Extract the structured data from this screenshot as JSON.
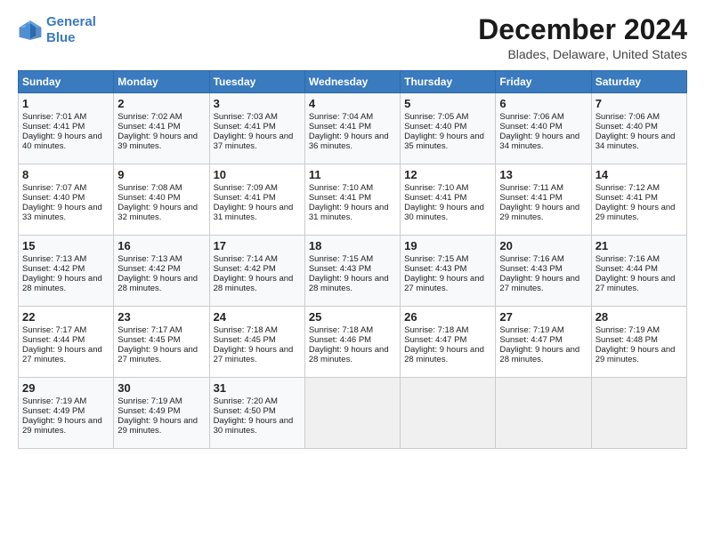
{
  "logo": {
    "line1": "General",
    "line2": "Blue"
  },
  "title": "December 2024",
  "subtitle": "Blades, Delaware, United States",
  "headers": [
    "Sunday",
    "Monday",
    "Tuesday",
    "Wednesday",
    "Thursday",
    "Friday",
    "Saturday"
  ],
  "weeks": [
    [
      {
        "day": "1",
        "sunrise": "Sunrise: 7:01 AM",
        "sunset": "Sunset: 4:41 PM",
        "daylight": "Daylight: 9 hours and 40 minutes."
      },
      {
        "day": "2",
        "sunrise": "Sunrise: 7:02 AM",
        "sunset": "Sunset: 4:41 PM",
        "daylight": "Daylight: 9 hours and 39 minutes."
      },
      {
        "day": "3",
        "sunrise": "Sunrise: 7:03 AM",
        "sunset": "Sunset: 4:41 PM",
        "daylight": "Daylight: 9 hours and 37 minutes."
      },
      {
        "day": "4",
        "sunrise": "Sunrise: 7:04 AM",
        "sunset": "Sunset: 4:41 PM",
        "daylight": "Daylight: 9 hours and 36 minutes."
      },
      {
        "day": "5",
        "sunrise": "Sunrise: 7:05 AM",
        "sunset": "Sunset: 4:40 PM",
        "daylight": "Daylight: 9 hours and 35 minutes."
      },
      {
        "day": "6",
        "sunrise": "Sunrise: 7:06 AM",
        "sunset": "Sunset: 4:40 PM",
        "daylight": "Daylight: 9 hours and 34 minutes."
      },
      {
        "day": "7",
        "sunrise": "Sunrise: 7:06 AM",
        "sunset": "Sunset: 4:40 PM",
        "daylight": "Daylight: 9 hours and 34 minutes."
      }
    ],
    [
      {
        "day": "8",
        "sunrise": "Sunrise: 7:07 AM",
        "sunset": "Sunset: 4:40 PM",
        "daylight": "Daylight: 9 hours and 33 minutes."
      },
      {
        "day": "9",
        "sunrise": "Sunrise: 7:08 AM",
        "sunset": "Sunset: 4:40 PM",
        "daylight": "Daylight: 9 hours and 32 minutes."
      },
      {
        "day": "10",
        "sunrise": "Sunrise: 7:09 AM",
        "sunset": "Sunset: 4:41 PM",
        "daylight": "Daylight: 9 hours and 31 minutes."
      },
      {
        "day": "11",
        "sunrise": "Sunrise: 7:10 AM",
        "sunset": "Sunset: 4:41 PM",
        "daylight": "Daylight: 9 hours and 31 minutes."
      },
      {
        "day": "12",
        "sunrise": "Sunrise: 7:10 AM",
        "sunset": "Sunset: 4:41 PM",
        "daylight": "Daylight: 9 hours and 30 minutes."
      },
      {
        "day": "13",
        "sunrise": "Sunrise: 7:11 AM",
        "sunset": "Sunset: 4:41 PM",
        "daylight": "Daylight: 9 hours and 29 minutes."
      },
      {
        "day": "14",
        "sunrise": "Sunrise: 7:12 AM",
        "sunset": "Sunset: 4:41 PM",
        "daylight": "Daylight: 9 hours and 29 minutes."
      }
    ],
    [
      {
        "day": "15",
        "sunrise": "Sunrise: 7:13 AM",
        "sunset": "Sunset: 4:42 PM",
        "daylight": "Daylight: 9 hours and 28 minutes."
      },
      {
        "day": "16",
        "sunrise": "Sunrise: 7:13 AM",
        "sunset": "Sunset: 4:42 PM",
        "daylight": "Daylight: 9 hours and 28 minutes."
      },
      {
        "day": "17",
        "sunrise": "Sunrise: 7:14 AM",
        "sunset": "Sunset: 4:42 PM",
        "daylight": "Daylight: 9 hours and 28 minutes."
      },
      {
        "day": "18",
        "sunrise": "Sunrise: 7:15 AM",
        "sunset": "Sunset: 4:43 PM",
        "daylight": "Daylight: 9 hours and 28 minutes."
      },
      {
        "day": "19",
        "sunrise": "Sunrise: 7:15 AM",
        "sunset": "Sunset: 4:43 PM",
        "daylight": "Daylight: 9 hours and 27 minutes."
      },
      {
        "day": "20",
        "sunrise": "Sunrise: 7:16 AM",
        "sunset": "Sunset: 4:43 PM",
        "daylight": "Daylight: 9 hours and 27 minutes."
      },
      {
        "day": "21",
        "sunrise": "Sunrise: 7:16 AM",
        "sunset": "Sunset: 4:44 PM",
        "daylight": "Daylight: 9 hours and 27 minutes."
      }
    ],
    [
      {
        "day": "22",
        "sunrise": "Sunrise: 7:17 AM",
        "sunset": "Sunset: 4:44 PM",
        "daylight": "Daylight: 9 hours and 27 minutes."
      },
      {
        "day": "23",
        "sunrise": "Sunrise: 7:17 AM",
        "sunset": "Sunset: 4:45 PM",
        "daylight": "Daylight: 9 hours and 27 minutes."
      },
      {
        "day": "24",
        "sunrise": "Sunrise: 7:18 AM",
        "sunset": "Sunset: 4:45 PM",
        "daylight": "Daylight: 9 hours and 27 minutes."
      },
      {
        "day": "25",
        "sunrise": "Sunrise: 7:18 AM",
        "sunset": "Sunset: 4:46 PM",
        "daylight": "Daylight: 9 hours and 28 minutes."
      },
      {
        "day": "26",
        "sunrise": "Sunrise: 7:18 AM",
        "sunset": "Sunset: 4:47 PM",
        "daylight": "Daylight: 9 hours and 28 minutes."
      },
      {
        "day": "27",
        "sunrise": "Sunrise: 7:19 AM",
        "sunset": "Sunset: 4:47 PM",
        "daylight": "Daylight: 9 hours and 28 minutes."
      },
      {
        "day": "28",
        "sunrise": "Sunrise: 7:19 AM",
        "sunset": "Sunset: 4:48 PM",
        "daylight": "Daylight: 9 hours and 29 minutes."
      }
    ],
    [
      {
        "day": "29",
        "sunrise": "Sunrise: 7:19 AM",
        "sunset": "Sunset: 4:49 PM",
        "daylight": "Daylight: 9 hours and 29 minutes."
      },
      {
        "day": "30",
        "sunrise": "Sunrise: 7:19 AM",
        "sunset": "Sunset: 4:49 PM",
        "daylight": "Daylight: 9 hours and 29 minutes."
      },
      {
        "day": "31",
        "sunrise": "Sunrise: 7:20 AM",
        "sunset": "Sunset: 4:50 PM",
        "daylight": "Daylight: 9 hours and 30 minutes."
      },
      null,
      null,
      null,
      null
    ]
  ]
}
